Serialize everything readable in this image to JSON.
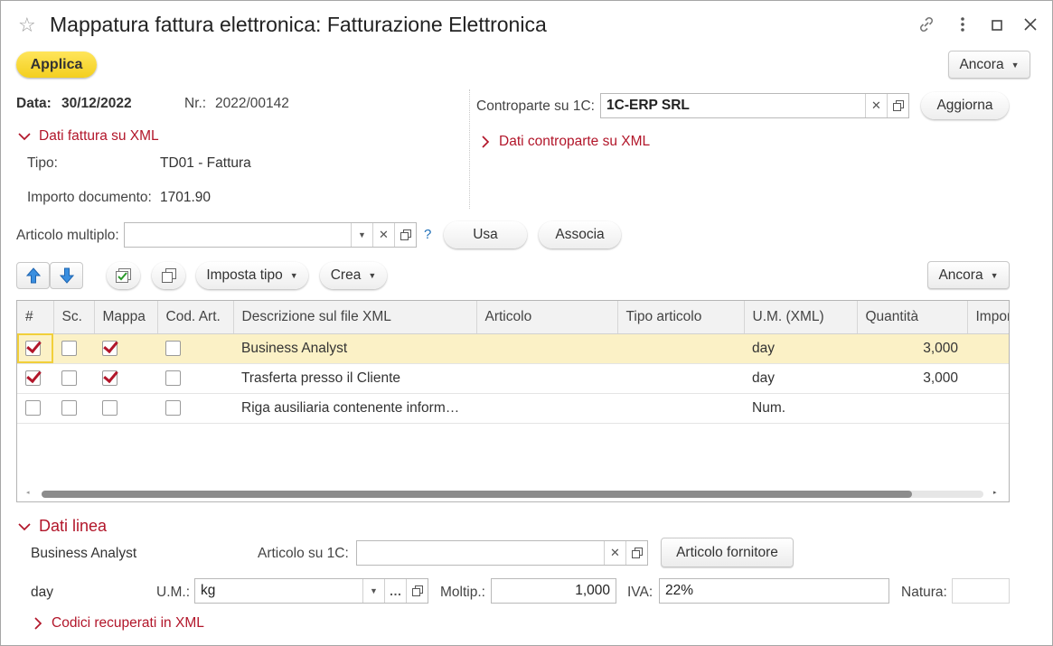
{
  "window": {
    "title": "Mappatura fattura elettronica: Fatturazione Elettronica"
  },
  "toolbar": {
    "apply_label": "Applica",
    "more_label": "Ancora"
  },
  "header": {
    "data_label": "Data:",
    "data_value": "30/12/2022",
    "nr_label": "Nr.:",
    "nr_value": "2022/00142",
    "dati_fattura_label": "Dati fattura su XML",
    "tipo_label": "Tipo:",
    "tipo_value": "TD01 - Fattura",
    "importo_label": "Importo documento:",
    "importo_value": "1701.90",
    "controparte_label": "Controparte su 1C:",
    "controparte_value": "1C-ERP SRL",
    "aggiorna_label": "Aggiorna",
    "dati_controparte_label": "Dati controparte su XML"
  },
  "articolo_multiplo": {
    "label": "Articolo multiplo:",
    "value": "",
    "help": "?",
    "usa_label": "Usa",
    "associa_label": "Associa"
  },
  "table_toolbar": {
    "imposta_tipo_label": "Imposta tipo",
    "crea_label": "Crea",
    "more_label": "Ancora"
  },
  "table": {
    "columns": [
      "#",
      "Sc.",
      "Mappa",
      "Cod. Art.",
      "Descrizione sul file XML",
      "Articolo",
      "Tipo articolo",
      "U.M. (XML)",
      "Quantità",
      "Impor"
    ],
    "rows": [
      {
        "hash": true,
        "sc": false,
        "mappa": true,
        "cod": false,
        "descrizione": "Business Analyst",
        "articolo": "",
        "tipo": "",
        "um": "day",
        "quantita": "3,000",
        "importo": ""
      },
      {
        "hash": true,
        "sc": false,
        "mappa": true,
        "cod": false,
        "descrizione": "Trasferta presso il Cliente",
        "articolo": "",
        "tipo": "",
        "um": "day",
        "quantita": "3,000",
        "importo": ""
      },
      {
        "hash": false,
        "sc": false,
        "mappa": false,
        "cod": false,
        "descrizione": "Riga ausiliaria contenente inform…",
        "articolo": "",
        "tipo": "",
        "um": "Num.",
        "quantita": "",
        "importo": ""
      }
    ]
  },
  "dati_linea": {
    "section_label": "Dati linea",
    "descrizione": "Business Analyst",
    "articolo_1c_label": "Articolo su 1C:",
    "articolo_1c_value": "",
    "articolo_fornitore_label": "Articolo fornitore",
    "um_xml": "day",
    "um_label": "U.M.:",
    "um_value": "kg",
    "moltip_label": "Moltip.:",
    "moltip_value": "1,000",
    "iva_label": "IVA:",
    "iva_value": "22%",
    "natura_label": "Natura:",
    "natura_value": "",
    "codici_label": "Codici recuperati in XML"
  }
}
